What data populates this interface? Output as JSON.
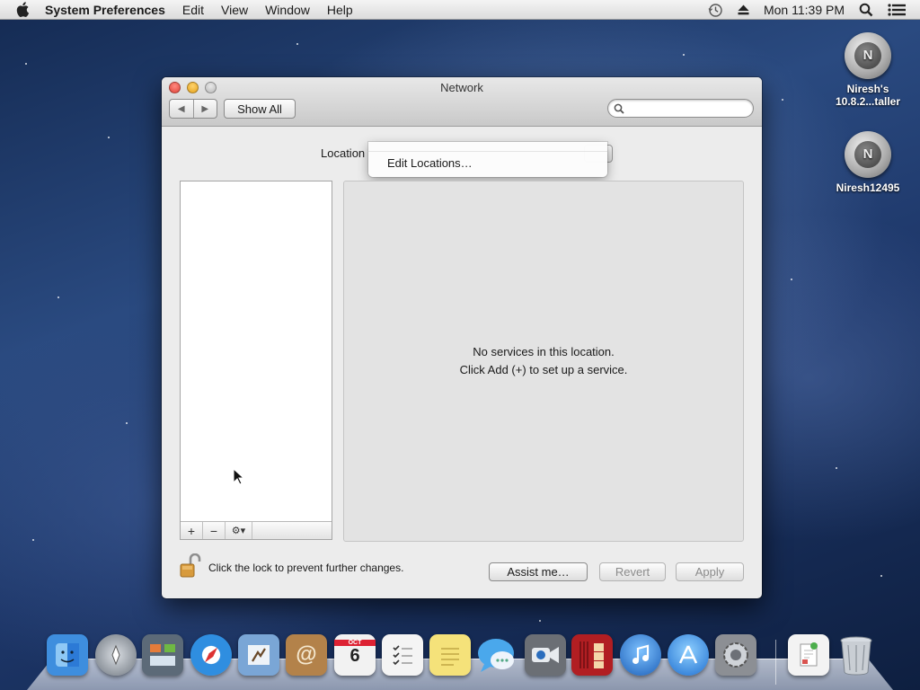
{
  "menubar": {
    "app_name": "System Preferences",
    "items": [
      "Edit",
      "View",
      "Window",
      "Help"
    ],
    "clock": "Mon 11:39 PM"
  },
  "desktop": {
    "icons": [
      {
        "label_line1": "Niresh's",
        "label_line2": "10.8.2...taller"
      },
      {
        "label_line1": "Niresh12495",
        "label_line2": ""
      }
    ],
    "disk_letter": "N"
  },
  "window": {
    "title": "Network",
    "show_all_label": "Show All",
    "search_placeholder": "",
    "location_label": "Location",
    "location_menu_item": "Edit Locations…",
    "empty_message_line1": "No services in this location.",
    "empty_message_line2": "Click Add (+) to set up a service.",
    "add_symbol": "+",
    "remove_symbol": "−",
    "action_symbol": "⚙▾",
    "lock_text": "Click the lock to prevent further changes.",
    "assist_label": "Assist me…",
    "revert_label": "Revert",
    "apply_label": "Apply"
  },
  "dock": {
    "calendar_day": "6",
    "calendar_month": "OCT",
    "items": [
      {
        "name": "finder-icon",
        "color": "#3e8ede"
      },
      {
        "name": "launchpad-icon",
        "color": "#9aa3ad"
      },
      {
        "name": "mission-control-icon",
        "color": "#5c6a78"
      },
      {
        "name": "safari-icon",
        "color": "#2f8ee0"
      },
      {
        "name": "mail-icon",
        "color": "#7aa6d6"
      },
      {
        "name": "contacts-icon",
        "color": "#b3824a"
      },
      {
        "name": "calendar-icon",
        "color": "#f2f2f2"
      },
      {
        "name": "reminders-icon",
        "color": "#f4f4f4"
      },
      {
        "name": "notes-icon",
        "color": "#f5e27a"
      },
      {
        "name": "messages-icon",
        "color": "#4aa8ec"
      },
      {
        "name": "facetime-icon",
        "color": "#6b6f75"
      },
      {
        "name": "photo-booth-icon",
        "color": "#b11e22"
      },
      {
        "name": "itunes-icon",
        "color": "#2c7fd8"
      },
      {
        "name": "app-store-icon",
        "color": "#3592e6"
      },
      {
        "name": "system-preferences-icon",
        "color": "#8c8f94"
      },
      {
        "name": "document-stack-icon",
        "color": "#f3f3f3"
      },
      {
        "name": "trash-icon",
        "color": "#c9ced4"
      }
    ]
  }
}
